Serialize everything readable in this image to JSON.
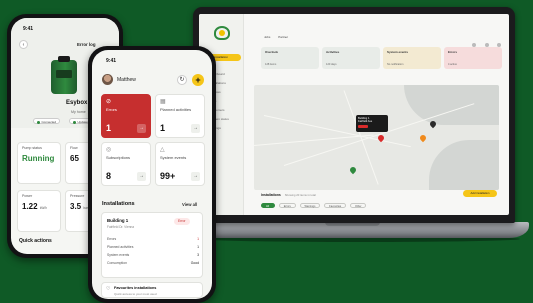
{
  "laptop": {
    "tabs": [
      "Jobs",
      "Partner"
    ],
    "new_installation": "New installation",
    "nav": [
      "Dashboard",
      "Installations",
      "Devices",
      "Jobs",
      "Customers",
      "System status",
      "Settings"
    ],
    "stats": [
      {
        "title": "Overlook",
        "sub": "128 items",
        "color": "#e8ece8"
      },
      {
        "title": "Activities",
        "sub": "120 days",
        "color": "#e8ece8"
      },
      {
        "title": "System events",
        "sub": "No notification",
        "color": "#f3ead2"
      },
      {
        "title": "Errors",
        "sub": "4 active",
        "color": "#f6dcdc"
      }
    ],
    "popup": {
      "title": "Building 1",
      "sub": "Fairfield Ave",
      "action": "Open"
    },
    "installations_title": "Installations",
    "installations_sub": "Showing 20 items in total",
    "add_button": "Add installation",
    "filters": [
      "All",
      "Errors",
      "Warnings",
      "Favourites",
      "Other"
    ]
  },
  "phone_back": {
    "time": "9:41",
    "title": "Error log",
    "device_name": "Esybox",
    "location": "My home",
    "tags": [
      "Connected",
      "Updated"
    ],
    "cards": [
      {
        "label": "Pump status",
        "value": "Running"
      },
      {
        "label": "Flow",
        "value": "65"
      },
      {
        "label": "Power",
        "value": "1.22"
      },
      {
        "label": "Pressure",
        "value": "3.5"
      }
    ],
    "unit_kw": "kW/h",
    "unit_bar": "bar",
    "quick_actions": "Quick actions"
  },
  "phone_front": {
    "time": "9:41",
    "user": "Matthew",
    "tiles": [
      {
        "label": "Errors",
        "value": "1"
      },
      {
        "label": "Planned activities",
        "value": "1"
      },
      {
        "label": "Subscriptions",
        "value": "8"
      },
      {
        "label": "System events",
        "value": "99+"
      }
    ],
    "section_title": "Installations",
    "view_all": "View all",
    "building": {
      "name": "Building 1",
      "address": "Fairfield Dr. Vienna",
      "badge": "Error",
      "rows": [
        {
          "label": "Errors",
          "value": "1"
        },
        {
          "label": "Planned activities",
          "value": "1"
        },
        {
          "label": "System events",
          "value": "3"
        },
        {
          "label": "Consumption",
          "value": "Good"
        }
      ]
    },
    "favourites": {
      "title": "Favourites installations",
      "sub": "Quick access to your most used"
    }
  },
  "colors": {
    "background": "#0f5a26",
    "brand_green": "#2f8a3e",
    "accent_yellow": "#f5c518",
    "error_red": "#c62f2f"
  }
}
